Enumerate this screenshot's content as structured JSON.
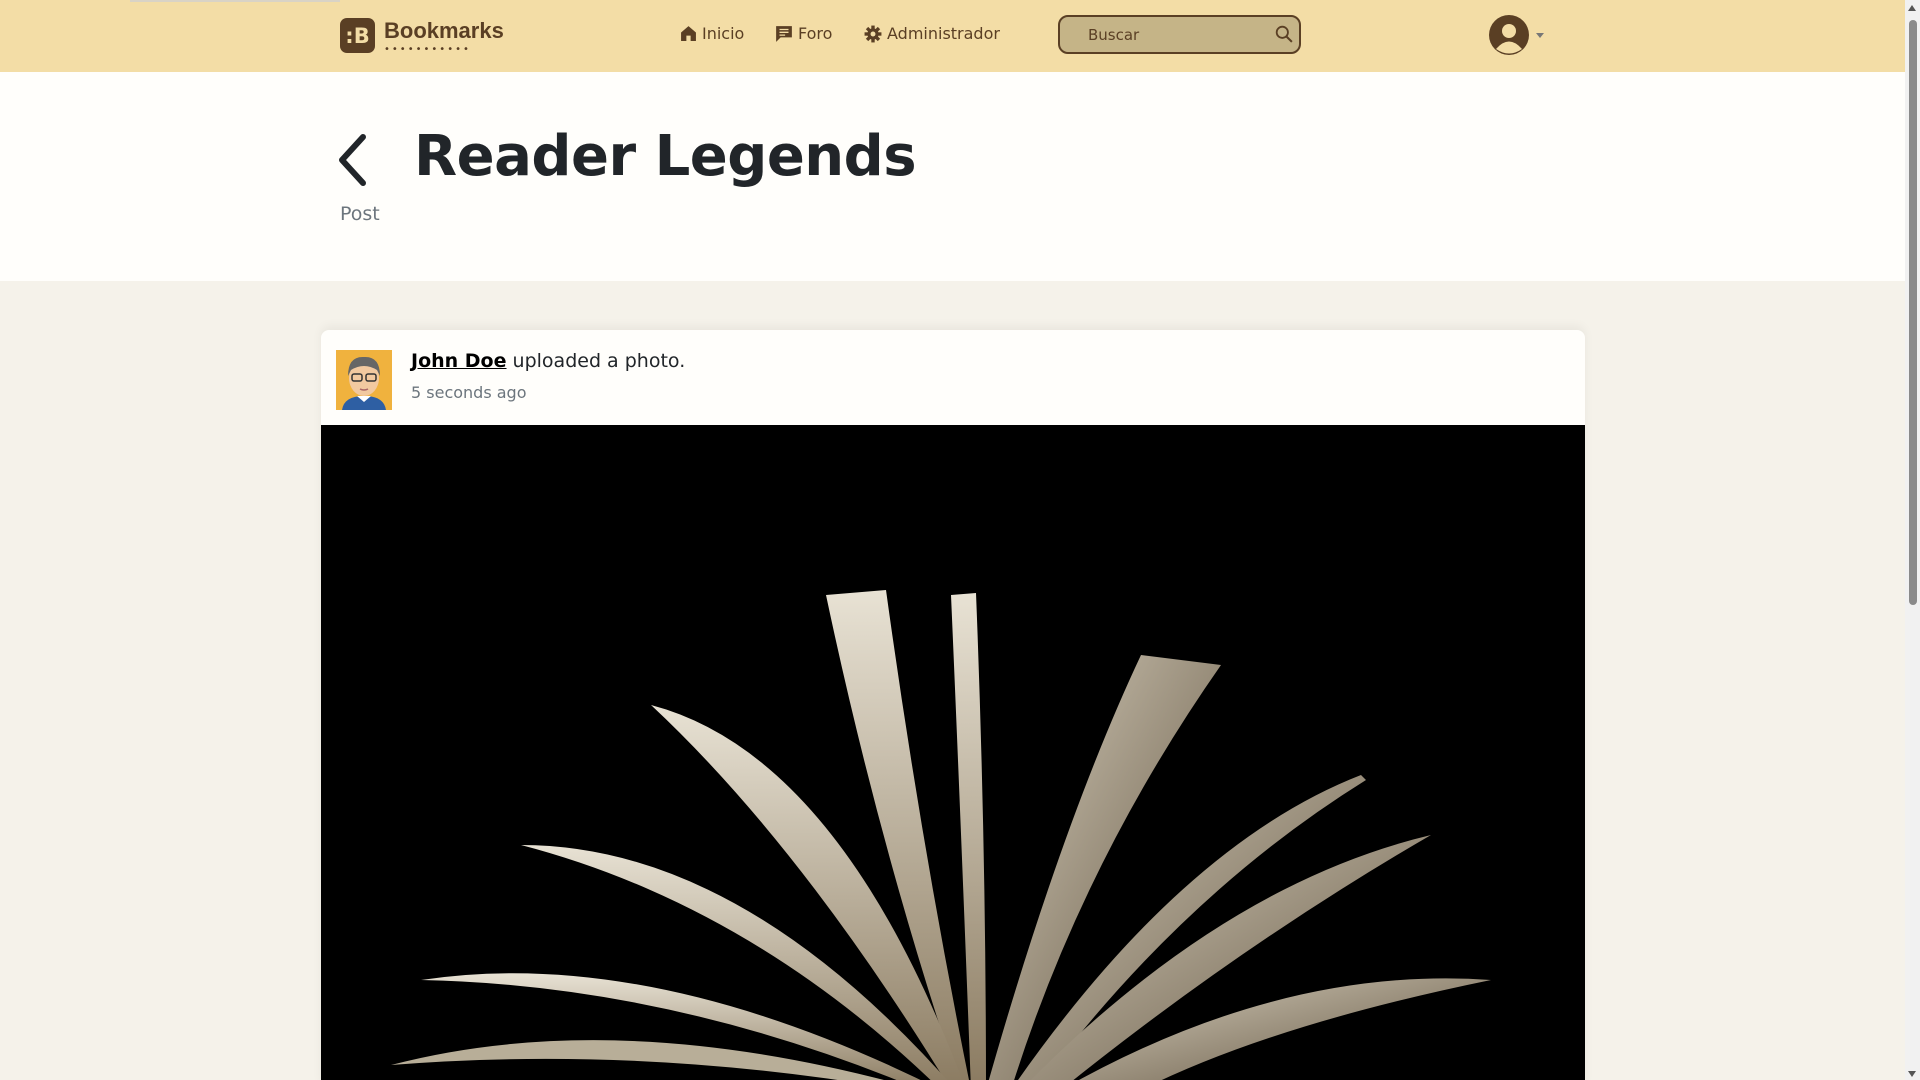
{
  "navbar": {
    "brand": "Bookmarks",
    "brand_badge": ":B",
    "brand_dots": "•••••••••••",
    "items": [
      {
        "label": "Inicio",
        "icon": "home-icon"
      },
      {
        "label": "Foro",
        "icon": "chat-icon"
      },
      {
        "label": "Administrador",
        "icon": "gear-icon"
      }
    ],
    "search_placeholder": "Buscar",
    "colors": {
      "bar": "#f3dda6",
      "accent": "#5a3f24",
      "search_bg": "#c5b487"
    }
  },
  "header": {
    "title": "Reader Legends",
    "subtitle": "Post"
  },
  "post": {
    "author": "John Doe",
    "action": " uploaded a photo.",
    "time": "5 seconds ago"
  }
}
